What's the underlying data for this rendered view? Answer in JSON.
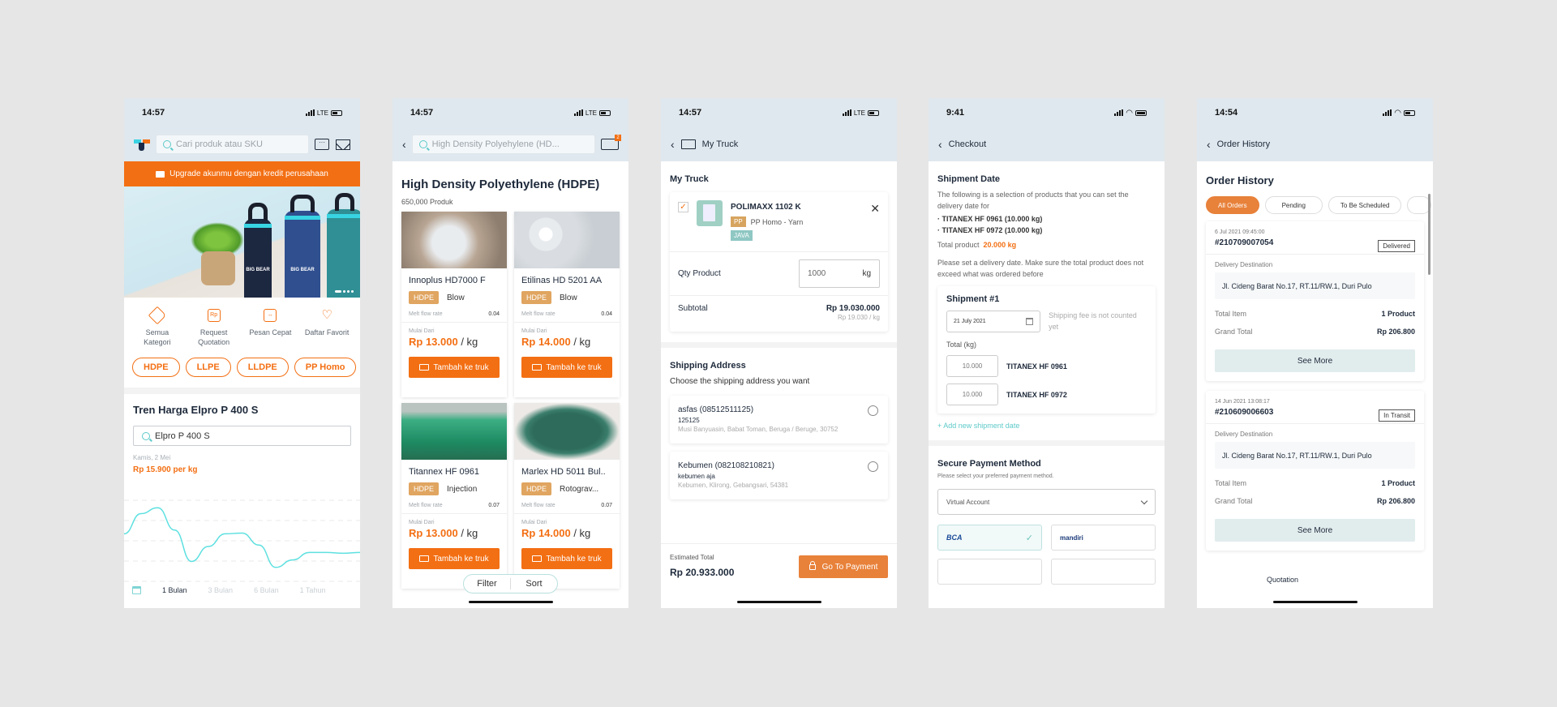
{
  "phone1": {
    "time": "14:57",
    "network": "LTE",
    "search_placeholder": "Cari produk atau SKU",
    "upgrade_banner": "Upgrade akunmu dengan kredit perusahaan",
    "banner_brand": "BIG BEAR",
    "quick_menu": [
      {
        "label": "Semua Kategori",
        "icon": "tag-icon"
      },
      {
        "label": "Request Quotation",
        "icon": "quotation-icon"
      },
      {
        "label": "Pesan Cepat",
        "icon": "box-icon"
      },
      {
        "label": "Daftar Favorit",
        "icon": "heart-icon"
      }
    ],
    "chips": [
      "HDPE",
      "LLPE",
      "LLDPE",
      "PP Homo"
    ],
    "trend_title": "Tren Harga Elpro P 400 S",
    "trend_search_value": "Elpro P 400 S",
    "trend_date": "Kamis, 2 Mei",
    "trend_price": "Rp 15.900 per kg",
    "ranges": [
      "1 Bulan",
      "3 Bulan",
      "6 Bulan",
      "1 Tahun"
    ],
    "active_range": "1 Bulan",
    "accent": "#f36f13",
    "line_color": "#5ee0e0"
  },
  "chart_data": {
    "type": "line",
    "title": "Tren Harga Elpro P 400 S",
    "xlabel": "",
    "ylabel": "",
    "x": [
      0,
      1,
      2,
      3,
      4,
      5,
      6,
      7,
      8,
      9,
      10,
      11,
      12,
      13,
      14
    ],
    "values": [
      0.55,
      0.82,
      0.9,
      0.6,
      0.18,
      0.38,
      0.55,
      0.56,
      0.4,
      0.1,
      0.2,
      0.3,
      0.3,
      0.29,
      0.3
    ],
    "ylim": [
      0,
      1
    ],
    "grid": true,
    "legend": "none"
  },
  "phone2": {
    "time": "14:57",
    "network": "LTE",
    "search_value": "High Density Polyehylene (HD...",
    "cart_count": "2",
    "title": "High Density Polyethylene (HDPE)",
    "count": "650,000 Produk",
    "mfr_label": "Melt flow rate",
    "from_label": "Mulai Dari",
    "per_unit": "/ kg",
    "add_label": "Tambah ke truk",
    "products": [
      {
        "name": "Innoplus HD7000 F",
        "type": "HDPE",
        "process": "Blow",
        "mfr": "0.04",
        "price": "Rp 13.000"
      },
      {
        "name": "Etilinas HD 5201 AA",
        "type": "HDPE",
        "process": "Blow",
        "mfr": "0.04",
        "price": "Rp 14.000"
      },
      {
        "name": "Titannex HF 0961",
        "type": "HDPE",
        "process": "Injection",
        "mfr": "0.07",
        "price": "Rp 13.000"
      },
      {
        "name": "Marlex HD 5011 Bul..",
        "type": "HDPE",
        "process": "Rotograv...",
        "mfr": "0.07",
        "price": "Rp 14.000"
      }
    ],
    "filter_label": "Filter",
    "sort_label": "Sort"
  },
  "phone3": {
    "time": "14:57",
    "network": "LTE",
    "nav_title": "My Truck",
    "section_title": "My Truck",
    "item": {
      "name": "POLIMAXX 1102 K",
      "type": "PP",
      "desc": "PP Homo - Yarn",
      "region": "JAVA",
      "checked": true
    },
    "qty_label": "Qty Product",
    "qty_value": "1000",
    "qty_unit": "kg",
    "subtotal_label": "Subtotal",
    "subtotal": "Rp 19.030.000",
    "unit_price": "Rp 19.030 / kg",
    "ship_title": "Shipping Address",
    "ship_sub": "Choose the shipping address you want",
    "addresses": [
      {
        "name": "asfas (08512511125)",
        "street": "125125",
        "detail": "Musi Banyuasin, Babat Toman, Beruga / Beruge, 30752"
      },
      {
        "name": "Kebumen (082108210821)",
        "street": "kebumen aja",
        "detail": "Kebumen, Klirong, Gebangsari, 54381"
      }
    ],
    "est_label": "Estimated Total",
    "est_total": "Rp 20.933.000",
    "pay_label": "Go To Payment"
  },
  "phone4": {
    "time": "9:41",
    "nav_title": "Checkout",
    "ship_date_title": "Shipment Date",
    "intro": "The following is a selection of products that you can set the delivery date for",
    "bullets": [
      "· TITANEX HF 0961 (10.000 kg)",
      "· TITANEX HF 0972 (10.000 kg)"
    ],
    "total_label": "Total product",
    "total_value": "20.000 kg",
    "instruction": "Please set a delivery date. Make sure the total product does not exceed what was ordered before",
    "shipment": {
      "title": "Shipment #1",
      "date": "21 July 2021",
      "note": "Shipping fee is not counted yet",
      "total_label": "Total (kg)",
      "items": [
        {
          "qty": "10.000",
          "name": "TITANEX HF 0961"
        },
        {
          "qty": "10.000",
          "name": "TITANEX HF 0972"
        }
      ]
    },
    "add_shipment": "+  Add new shipment date",
    "pay_title": "Secure Payment Method",
    "pay_sub": "Please select your preferred payment method.",
    "pay_select": "Virtual Account",
    "banks": [
      {
        "name": "BCA",
        "selected": true
      },
      {
        "name": "mandiri",
        "selected": false
      }
    ]
  },
  "phone5": {
    "time": "14:54",
    "nav_title": "Order History",
    "title": "Order History",
    "tabs": [
      "All Orders",
      "Pending",
      "To Be Scheduled"
    ],
    "active_tab": "All Orders",
    "dest_label": "Delivery Destination",
    "total_item_label": "Total Item",
    "grand_total_label": "Grand Total",
    "see_more": "See More",
    "orders": [
      {
        "datetime": "6 Jul 2021 09:45:00",
        "id": "#210709007054",
        "status": "Delivered",
        "address": "Jl. Cideng Barat No.17, RT.11/RW.1, Duri Pulo",
        "total_item": "1 Product",
        "grand_total": "Rp 206.800"
      },
      {
        "datetime": "14 Jun 2021 13:08:17",
        "id": "#210609006603",
        "status": "In Transit",
        "address": "Jl. Cideng Barat No.17, RT.11/RW.1, Duri Pulo",
        "total_item": "1 Product",
        "grand_total": "Rp 206.800"
      }
    ],
    "bottom_tab": "Quotation"
  }
}
